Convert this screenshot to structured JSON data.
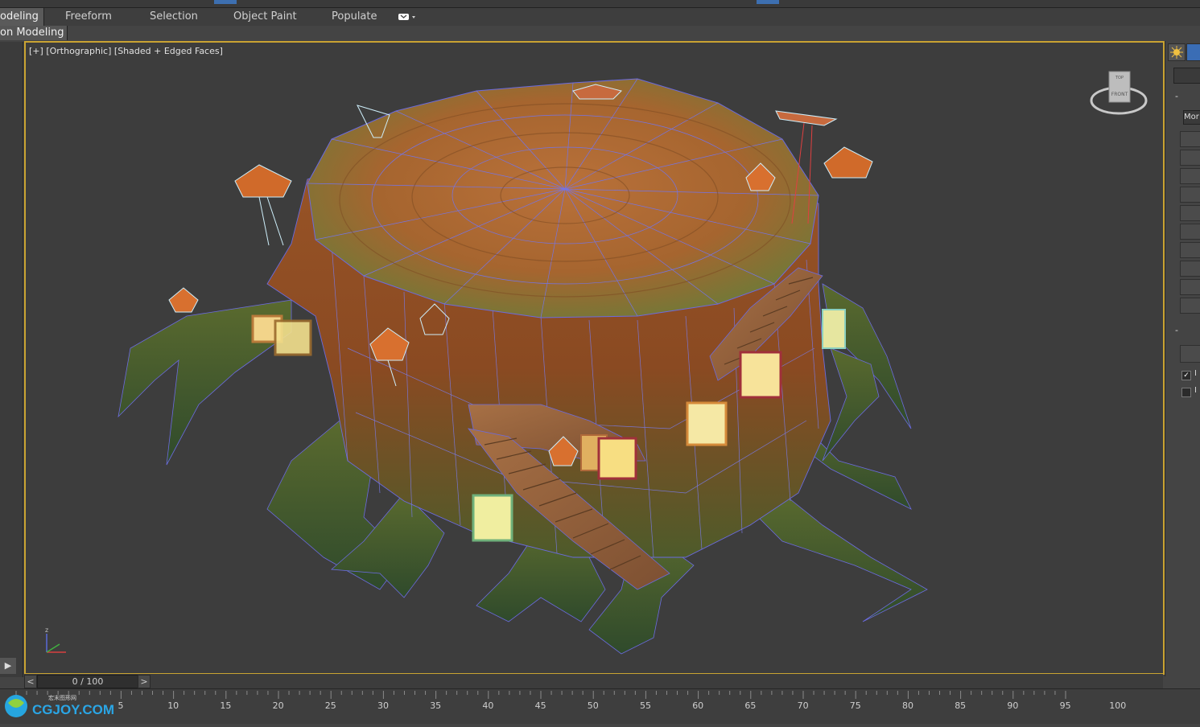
{
  "ribbon": {
    "tabs": [
      {
        "label": "odeling",
        "active": true
      },
      {
        "label": "Freeform"
      },
      {
        "label": "Selection"
      },
      {
        "label": "Object Paint"
      },
      {
        "label": "Populate"
      }
    ],
    "sub_label": "on Modeling"
  },
  "viewport": {
    "label_plus": "[+]",
    "label_view": "[Orthographic]",
    "label_shading": "[Shaded + Edged Faces]",
    "viewcube_top": "TOP",
    "viewcube_front": "FRONT",
    "axis_z": "z",
    "border_color": "#c9a332",
    "scene": "stylized tree stump house with staircase, lanterns and mushrooms"
  },
  "right_panel": {
    "dropdown": "Mor",
    "checkbox_1_label": "I",
    "checkbox_1_checked": true,
    "checkbox_2_label": "I",
    "checkbox_2_checked": false,
    "rollout_toggle": "-"
  },
  "time_slider": {
    "prev": "<",
    "next": ">",
    "frame": "0 / 100"
  },
  "track_bar": {
    "ticks": [
      "5",
      "10",
      "15",
      "20",
      "25",
      "30",
      "35",
      "40",
      "45",
      "50",
      "55",
      "60",
      "65",
      "70",
      "75",
      "80",
      "85",
      "90",
      "95",
      "100"
    ]
  },
  "watermark": {
    "text": "CGJOY.COM",
    "sub": "宏末图形网"
  },
  "left_strip": {
    "play": "▶"
  }
}
